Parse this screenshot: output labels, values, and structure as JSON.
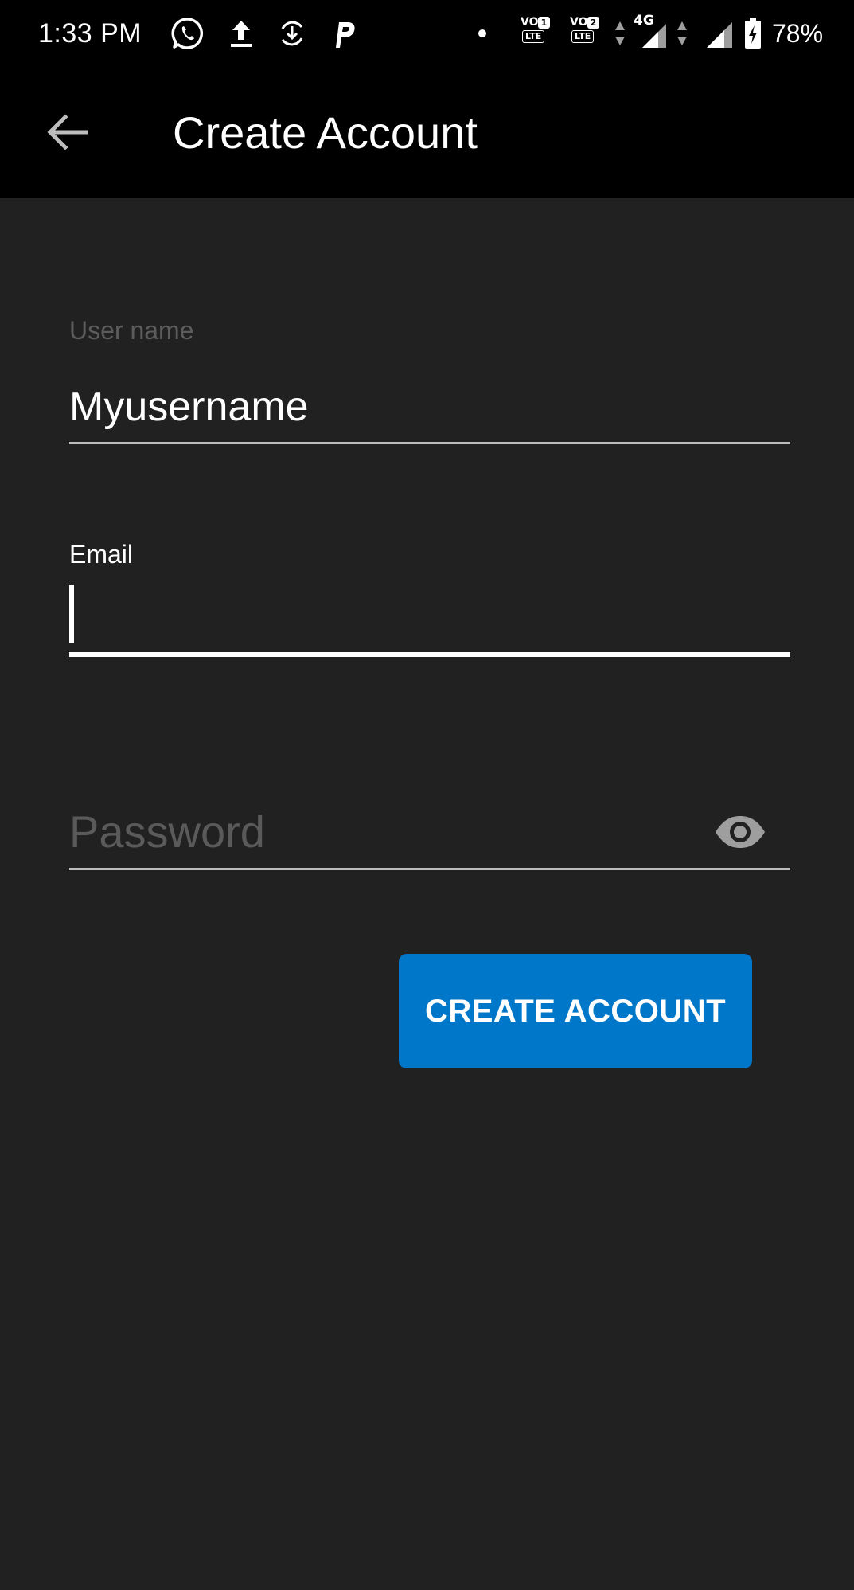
{
  "status_bar": {
    "time": "1:33 PM",
    "icons": [
      "whatsapp-icon",
      "upload-icon",
      "download-sync-icon",
      "p-app-icon",
      "dot-icon",
      "volte-sim1-icon",
      "volte-sim2-icon",
      "4g-signal-icon",
      "signal-icon",
      "battery-charging-icon"
    ],
    "sim1": {
      "vo": "VO",
      "num": "1",
      "lte": "LTE"
    },
    "sim2": {
      "vo": "VO",
      "num": "2",
      "lte": "LTE"
    },
    "network": "4G",
    "battery": "78%"
  },
  "app_bar": {
    "back_icon": "arrow-back-icon",
    "title": "Create Account"
  },
  "form": {
    "username": {
      "label": "User name",
      "value": "Myusername"
    },
    "email": {
      "label": "Email",
      "value": ""
    },
    "password": {
      "placeholder": "Password",
      "toggle_icon": "eye-icon"
    },
    "submit_label": "CREATE ACCOUNT"
  },
  "colors": {
    "background": "#212121",
    "app_bar": "#000000",
    "accent_button": "#0077c8",
    "text": "#ffffff",
    "hint": "#5c5c5c"
  }
}
